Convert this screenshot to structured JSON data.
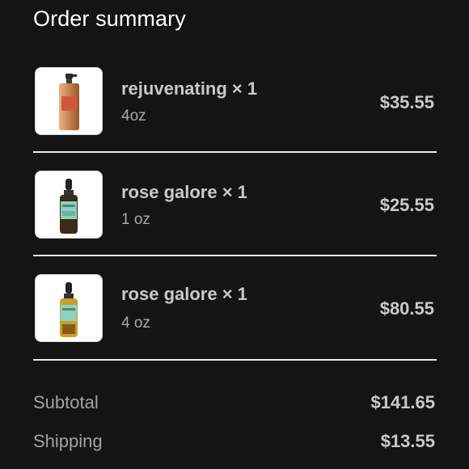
{
  "order_summary": {
    "title": "Order summary",
    "items": [
      {
        "name": "rejuvenating × 1",
        "size": "4oz",
        "price": "$35.55",
        "thumbnail_icon": "spray-bottle-icon"
      },
      {
        "name": "rose galore × 1",
        "size": "1 oz",
        "price": "$25.55",
        "thumbnail_icon": "dropper-bottle-icon"
      },
      {
        "name": "rose galore × 1",
        "size": "4 oz",
        "price": "$80.55",
        "thumbnail_icon": "dropper-bottle-icon"
      }
    ],
    "subtotal": {
      "label": "Subtotal",
      "value": "$141.65"
    },
    "shipping": {
      "label": "Shipping",
      "value": "$13.55"
    }
  },
  "colors": {
    "background": "#141414",
    "divider": "#e9e9e9",
    "text_primary": "#c9c9c9",
    "text_secondary": "#a9a9a9"
  }
}
